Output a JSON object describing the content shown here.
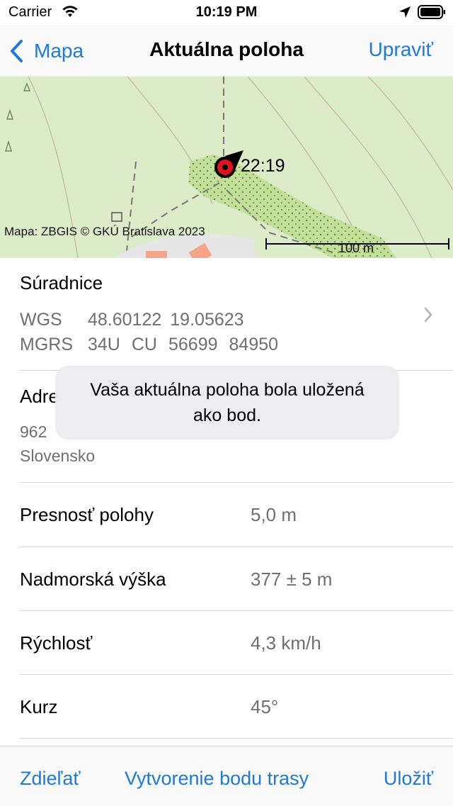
{
  "status_bar": {
    "carrier": "Carrier",
    "time": "10:19 PM"
  },
  "nav": {
    "back_label": "Mapa",
    "title": "Aktuálna poloha",
    "edit_label": "Upraviť"
  },
  "map": {
    "attribution": "Mapa: ZBGIS © GKÚ Bratislava 2023",
    "marker_time": "22:19",
    "scale_label": "100 m"
  },
  "coordinates": {
    "title": "Súradnice",
    "wgs": {
      "label": "WGS",
      "lat": "48.60122",
      "lon": "19.05623"
    },
    "mgrs": {
      "label": "MGRS",
      "zone": "34U",
      "square": "CU",
      "easting": "56699",
      "northing": "84950"
    }
  },
  "address": {
    "title": "Adre",
    "line1": "962",
    "line2": "Slovensko"
  },
  "toast": {
    "line1": "Vaša aktuálna poloha bola uložená",
    "line2": "ako bod."
  },
  "info": [
    {
      "label": "Presnosť polohy",
      "value": "5,0 m"
    },
    {
      "label": "Nadmorská výška",
      "value": "377 ± 5 m"
    },
    {
      "label": "Rýchlosť",
      "value": "4,3 km/h"
    },
    {
      "label": "Kurz",
      "value": "45°"
    }
  ],
  "toolbar": {
    "share": "Zdieľať",
    "create_waypoint": "Vytvorenie bodu trasy",
    "save": "Uložiť"
  },
  "colors": {
    "accent": "#1e7ad6",
    "marker": "#e0141e",
    "map_bg": "#dcebc8",
    "forest": "#c3df9a"
  }
}
